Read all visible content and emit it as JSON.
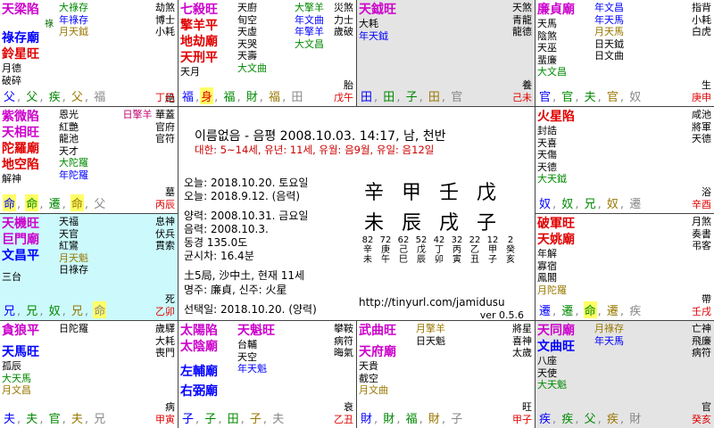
{
  "header": {
    "title": "이름없음 - 음평 2008.10.03. 14:17, 남, 천반",
    "luck": "대한: 5~14세, 유년: 11세, 유월: 음9월, 유일: 음12일"
  },
  "info": {
    "today_solar": "오늘: 2018.10.20. 토요일",
    "today_lunar": "오늘: 2018.9.12. (음력)",
    "birth_solar": "양력: 2008.10.31. 금요일",
    "birth_lunar": "음력: 2008.10.3.",
    "longitude": "동경 135.0도",
    "time_diff": "균시차: 16.4분",
    "bureau": "土5局, 沙中土, 현재 11세",
    "master": "명주: 廉貞, 신주: 火星",
    "selected": "선택일: 2018.10.20. (양력)",
    "url": "http://tinyurl.com/jamidusu",
    "version": "ver 0.5.6"
  },
  "pillars": {
    "stems": [
      "辛",
      "甲",
      "壬",
      "戊"
    ],
    "branches": [
      "未",
      "辰",
      "戌",
      "子"
    ]
  },
  "daeun": {
    "ages": [
      "82",
      "72",
      "62",
      "52",
      "42",
      "32",
      "22",
      "12",
      "2"
    ],
    "stems": [
      "辛",
      "庚",
      "己",
      "戊",
      "丁",
      "丙",
      "乙",
      "甲",
      "癸"
    ],
    "branches": [
      "未",
      "午",
      "巳",
      "辰",
      "卯",
      "寅",
      "丑",
      "子",
      "亥"
    ]
  },
  "palaces": {
    "si": {
      "a": [
        "天梁陷",
        "祿存廟",
        "鈴星旺",
        "月德",
        "破碎"
      ],
      "a_badge": "祿",
      "b": [
        "大祿存",
        "年祿存",
        "月天鉞"
      ],
      "c": [
        "劫煞",
        "博士",
        "小耗"
      ],
      "bot": [
        "父",
        "父",
        "疾",
        "父",
        "福"
      ],
      "br": [
        "絶",
        "丁巳"
      ]
    },
    "o": {
      "a": [
        "七殺旺",
        "擎羊平",
        "地劫廟",
        "天刑平",
        "天月"
      ],
      "b": [
        "天廚",
        "旬空",
        "天虛",
        "天哭",
        "天壽",
        "大文曲"
      ],
      "c": [
        "大擎羊",
        "年文曲",
        "年擎羊",
        "大文昌"
      ],
      "c2": [
        "災煞",
        "力士",
        "歲破"
      ],
      "bot": [
        "福",
        "身",
        "福",
        "財",
        "福",
        "田"
      ],
      "br": [
        "胎",
        "戊午"
      ]
    },
    "mi": {
      "a": [
        "天鉞旺",
        "大耗",
        "年天鉞"
      ],
      "c": [
        "天煞",
        "青龍",
        "龍德"
      ],
      "bot": [
        "田",
        "田",
        "子",
        "田",
        "官"
      ],
      "br": [
        "養",
        "己未"
      ]
    },
    "sin": {
      "a": [
        "廉貞廟",
        "天馬",
        "陰煞",
        "天巫",
        "蜚廉",
        "大文昌"
      ],
      "b": [
        "年文昌",
        "年天馬",
        "月天馬",
        "日天鉞",
        "日文曲"
      ],
      "c": [
        "指背",
        "小耗",
        "白虎"
      ],
      "bot": [
        "官",
        "官",
        "夫",
        "官",
        "奴"
      ],
      "br": [
        "生",
        "庚申"
      ]
    },
    "jin": {
      "a": [
        "紫微陷",
        "天相旺",
        "陀羅廟",
        "地空陷",
        "解神"
      ],
      "b": [
        "恩光",
        "紅艷",
        "龍池",
        "天才",
        "大陀羅",
        "年陀羅"
      ],
      "c": [
        "日擎羊",
        "華蓋",
        "官府",
        "官符"
      ],
      "bot": [
        "命",
        "命",
        "遷",
        "命",
        "父"
      ],
      "br": [
        "墓",
        "丙辰"
      ]
    },
    "yu": {
      "a": [
        "火星陷",
        "封誥",
        "天喜",
        "天傷",
        "天德",
        "大天鉞"
      ],
      "c": [
        "咸池",
        "將軍",
        "天德"
      ],
      "bot": [
        "奴",
        "奴",
        "兄",
        "奴",
        "遷"
      ],
      "br": [
        "浴",
        "辛酉"
      ]
    },
    "myo": {
      "a": [
        "天機旺",
        "巨門廟",
        "文昌平",
        "三台"
      ],
      "b": [
        "天福",
        "天官",
        "紅鸞",
        "月天魁",
        "日祿存"
      ],
      "c": [
        "息神",
        "伏兵",
        "貫索"
      ],
      "bot": [
        "兄",
        "兄",
        "奴",
        "兄",
        "命"
      ],
      "br": [
        "死",
        "乙卯"
      ]
    },
    "sul": {
      "a": [
        "破軍旺",
        "天姚廟",
        "年解",
        "寡宿",
        "鳳閣",
        "月陀羅"
      ],
      "c": [
        "月煞",
        "奏書",
        "弔客"
      ],
      "bot": [
        "遷",
        "遷",
        "命",
        "遷",
        "疾"
      ],
      "br": [
        "帶",
        "壬戌"
      ]
    },
    "in": {
      "a": [
        "貪狼平",
        "天馬旺",
        "孤辰",
        "大天馬",
        "月文昌"
      ],
      "b": [
        "日陀羅"
      ],
      "c": [
        "歲驛",
        "大耗",
        "喪門"
      ],
      "bot": [
        "夫",
        "夫",
        "官",
        "夫",
        "兄"
      ],
      "br": [
        "病",
        "甲寅"
      ]
    },
    "chuk": {
      "a": [
        "太陽陷",
        "太陰廟",
        "左輔廟",
        "右弼廟"
      ],
      "b": [
        "天魁旺",
        "台輔",
        "天空",
        "年天魁"
      ],
      "c": [
        "攀鞍",
        "病符",
        "晦氣"
      ],
      "bot": [
        "子",
        "子",
        "田",
        "子",
        "夫"
      ],
      "br": [
        "衰",
        "乙丑"
      ]
    },
    "ja": {
      "a": [
        "武曲旺",
        "天府廟",
        "天貴",
        "截空",
        "月文曲"
      ],
      "b": [
        "月擎羊",
        "日天魁"
      ],
      "c": [
        "將星",
        "喜神",
        "太歲"
      ],
      "bot": [
        "財",
        "財",
        "福",
        "財",
        "子"
      ],
      "br": [
        "旺",
        "甲子"
      ]
    },
    "hae": {
      "a": [
        "天同廟",
        "文曲旺",
        "八座",
        "天使",
        "大天魁"
      ],
      "b": [
        "月祿存",
        "年天馬"
      ],
      "c": [
        "亡神",
        "飛廉",
        "病符"
      ],
      "bot": [
        "疾",
        "疾",
        "父",
        "疾",
        "財"
      ],
      "br": [
        "官",
        "癸亥"
      ]
    }
  }
}
